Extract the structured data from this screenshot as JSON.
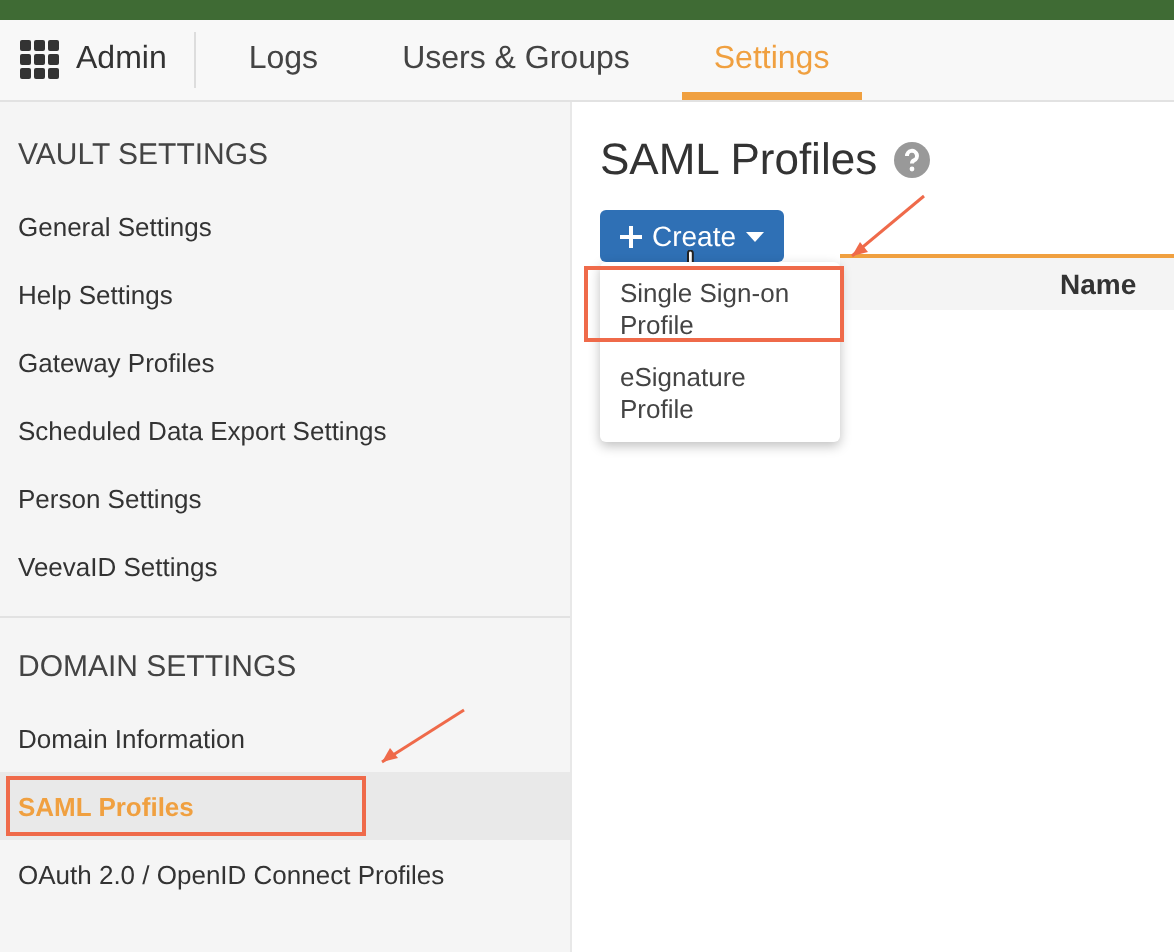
{
  "nav": {
    "brand": "Admin",
    "tabs": [
      {
        "label": "Logs",
        "selected": false
      },
      {
        "label": "Users & Groups",
        "selected": false
      },
      {
        "label": "Settings",
        "selected": true
      }
    ]
  },
  "sidebar": {
    "sections": [
      {
        "title": "VAULT SETTINGS",
        "items": [
          {
            "label": "General Settings",
            "selected": false,
            "highlighted": false
          },
          {
            "label": "Help Settings",
            "selected": false,
            "highlighted": false
          },
          {
            "label": "Gateway Profiles",
            "selected": false,
            "highlighted": false
          },
          {
            "label": "Scheduled Data Export Settings",
            "selected": false,
            "highlighted": false
          },
          {
            "label": "Person Settings",
            "selected": false,
            "highlighted": false
          },
          {
            "label": "VeevaID Settings",
            "selected": false,
            "highlighted": false
          }
        ]
      },
      {
        "title": "DOMAIN SETTINGS",
        "items": [
          {
            "label": "Domain Information",
            "selected": false,
            "highlighted": false
          },
          {
            "label": "SAML Profiles",
            "selected": true,
            "highlighted": true
          },
          {
            "label": "OAuth 2.0 / OpenID Connect Profiles",
            "selected": false,
            "highlighted": false
          }
        ]
      }
    ]
  },
  "main": {
    "title": "SAML Profiles",
    "create_button": "Create",
    "dropdown": [
      {
        "label": "Single Sign-on Profile",
        "highlighted": true
      },
      {
        "label": "eSignature Profile",
        "highlighted": false
      }
    ],
    "table": {
      "columns": [
        "Name"
      ]
    }
  }
}
